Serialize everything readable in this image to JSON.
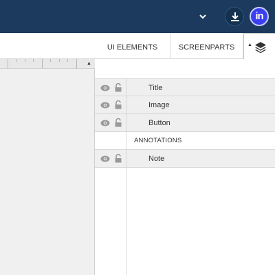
{
  "header": {
    "menu_chevron_icon": "chevron-down-icon",
    "download_icon": "download-icon",
    "logo_text": "in",
    "brand_color": "#1b3a5e",
    "logo_color": "#3b3ff0"
  },
  "tabs": {
    "ui_elements": "UI ELEMENTS",
    "screenparts": "SCREENPARTS",
    "layers_icon": "layers-icon",
    "collapse_icon": "triangle-up-icon"
  },
  "layers": {
    "rows": [
      {
        "label": "Title",
        "type": "layer"
      },
      {
        "label": "Image",
        "type": "layer"
      },
      {
        "label": "Button",
        "type": "layer"
      },
      {
        "label": "ANNOTATIONS",
        "type": "section"
      },
      {
        "label": "Note",
        "type": "layer"
      }
    ]
  }
}
